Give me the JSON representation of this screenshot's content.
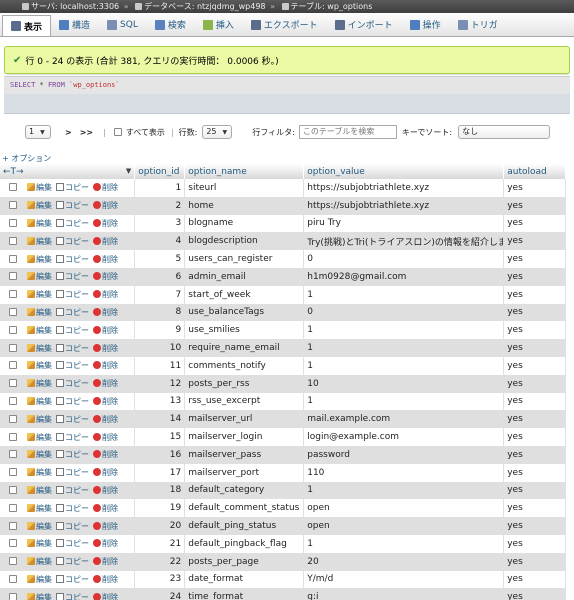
{
  "breadcrumb": {
    "server_label": "サーバ: localhost:3306",
    "database_label": "データベース: ntzjqdmg_wp498",
    "table_label": "テーブル: wp_options",
    "separator": "»"
  },
  "tabs": [
    {
      "label": "表示",
      "icon": "browse-icon",
      "color": "#5b6d8c",
      "active": true
    },
    {
      "label": "構造",
      "icon": "structure-icon",
      "color": "#4f7ec0",
      "active": false
    },
    {
      "label": "SQL",
      "icon": "sql-icon",
      "color": "#7b8fb5",
      "active": false
    },
    {
      "label": "検索",
      "icon": "search-icon",
      "color": "#5a82c0",
      "active": false
    },
    {
      "label": "挿入",
      "icon": "insert-icon",
      "color": "#8bb44a",
      "active": false
    },
    {
      "label": "エクスポート",
      "icon": "export-icon",
      "color": "#5b6d8c",
      "active": false
    },
    {
      "label": "インポート",
      "icon": "import-icon",
      "color": "#5b6d8c",
      "active": false
    },
    {
      "label": "操作",
      "icon": "operations-icon",
      "color": "#4f7ec0",
      "active": false
    },
    {
      "label": "トリガ",
      "icon": "triggers-icon",
      "color": "#7b8fb5",
      "active": false
    }
  ],
  "message": {
    "text": "行 0 - 24 の表示 (合計 381, クエリの実行時間： 0.0006 秒。)"
  },
  "sql": {
    "keyword1": "SELECT",
    "star": " * ",
    "keyword2": "FROM",
    "table": " `wp_options`"
  },
  "nav": {
    "page_value": "1",
    "next": ">",
    "last": ">>",
    "show_all": "すべて表示",
    "rows_label": "行数:",
    "rows_value": "25",
    "filter_label": "行フィルタ:",
    "filter_placeholder": "このテーブルを検索",
    "sort_label": "キーでソート:",
    "sort_value": "なし"
  },
  "options_link": "+ オプション",
  "columns": {
    "arrows": "←T→",
    "sort_caret": "▼",
    "id": "option_id",
    "name": "option_name",
    "value": "option_value",
    "autoload": "autoload"
  },
  "actions": {
    "edit": "編集",
    "copy": "コピー",
    "delete": "削除"
  },
  "rows": [
    {
      "id": "1",
      "name": "siteurl",
      "value": "https://subjobtriathlete.xyz",
      "autoload": "yes"
    },
    {
      "id": "2",
      "name": "home",
      "value": "https://subjobtriathlete.xyz",
      "autoload": "yes"
    },
    {
      "id": "3",
      "name": "blogname",
      "value": "piru Try",
      "autoload": "yes"
    },
    {
      "id": "4",
      "name": "blogdescription",
      "value": "Try(挑戦)とTri(トライアスロン)の情報を紹介します",
      "autoload": "yes"
    },
    {
      "id": "5",
      "name": "users_can_register",
      "value": "0",
      "autoload": "yes"
    },
    {
      "id": "6",
      "name": "admin_email",
      "value": "h1m0928@gmail.com",
      "autoload": "yes"
    },
    {
      "id": "7",
      "name": "start_of_week",
      "value": "1",
      "autoload": "yes"
    },
    {
      "id": "8",
      "name": "use_balanceTags",
      "value": "0",
      "autoload": "yes"
    },
    {
      "id": "9",
      "name": "use_smilies",
      "value": "1",
      "autoload": "yes"
    },
    {
      "id": "10",
      "name": "require_name_email",
      "value": "1",
      "autoload": "yes"
    },
    {
      "id": "11",
      "name": "comments_notify",
      "value": "1",
      "autoload": "yes"
    },
    {
      "id": "12",
      "name": "posts_per_rss",
      "value": "10",
      "autoload": "yes"
    },
    {
      "id": "13",
      "name": "rss_use_excerpt",
      "value": "1",
      "autoload": "yes"
    },
    {
      "id": "14",
      "name": "mailserver_url",
      "value": "mail.example.com",
      "autoload": "yes"
    },
    {
      "id": "15",
      "name": "mailserver_login",
      "value": "login@example.com",
      "autoload": "yes"
    },
    {
      "id": "16",
      "name": "mailserver_pass",
      "value": "password",
      "autoload": "yes"
    },
    {
      "id": "17",
      "name": "mailserver_port",
      "value": "110",
      "autoload": "yes"
    },
    {
      "id": "18",
      "name": "default_category",
      "value": "1",
      "autoload": "yes"
    },
    {
      "id": "19",
      "name": "default_comment_status",
      "value": "open",
      "autoload": "yes"
    },
    {
      "id": "20",
      "name": "default_ping_status",
      "value": "open",
      "autoload": "yes"
    },
    {
      "id": "21",
      "name": "default_pingback_flag",
      "value": "1",
      "autoload": "yes"
    },
    {
      "id": "22",
      "name": "posts_per_page",
      "value": "20",
      "autoload": "yes"
    },
    {
      "id": "23",
      "name": "date_format",
      "value": "Y/m/d",
      "autoload": "yes"
    },
    {
      "id": "24",
      "name": "time_format",
      "value": "g:i",
      "autoload": "yes"
    }
  ]
}
